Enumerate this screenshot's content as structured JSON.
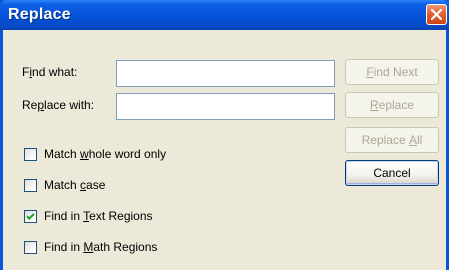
{
  "window": {
    "title": "Replace"
  },
  "fields": {
    "find_label_pre": "F",
    "find_label_ul": "i",
    "find_label_post": "nd what:",
    "find_value": "",
    "replace_label_pre": "Re",
    "replace_label_ul": "p",
    "replace_label_post": "lace with:",
    "replace_value": ""
  },
  "buttons": {
    "find_next": {
      "pre": "",
      "ul": "F",
      "post": "ind Next",
      "enabled": false
    },
    "replace": {
      "pre": "",
      "ul": "R",
      "post": "eplace",
      "enabled": false
    },
    "replace_all": {
      "pre": "Replace ",
      "ul": "A",
      "post": "ll",
      "enabled": false
    },
    "cancel": {
      "label": "Cancel",
      "enabled": true
    }
  },
  "options": [
    {
      "pre": "Match ",
      "ul": "w",
      "post": "hole word only",
      "checked": false
    },
    {
      "pre": "Match ",
      "ul": "c",
      "post": "ase",
      "checked": false
    },
    {
      "pre": "Find in ",
      "ul": "T",
      "post": "ext Regions",
      "checked": true
    },
    {
      "pre": "Find in ",
      "ul": "M",
      "post": "ath Regions",
      "checked": false
    }
  ],
  "icons": {
    "close": "close-icon",
    "check": "checkmark-icon"
  },
  "colors": {
    "titlebar": "#0553d8",
    "client": "#ece9d8",
    "close": "#e2602f",
    "checkmark": "#21a121",
    "disabled_text": "#aca899"
  }
}
